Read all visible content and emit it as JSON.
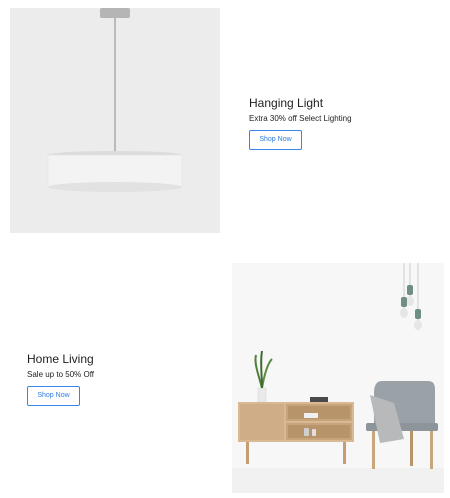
{
  "promos": [
    {
      "title": "Hanging Light",
      "subtitle": "Extra 30% off Select Lighting",
      "button_label": "Shop Now",
      "image": "pendant-lamp-image"
    },
    {
      "title": "Home Living",
      "subtitle": "Sale up to 50% Off",
      "button_label": "Shop Now",
      "image": "living-room-image"
    }
  ],
  "colors": {
    "accent": "#3a86e8",
    "image_bg_1": "#ececec",
    "image_bg_2": "#f7f7f7"
  }
}
